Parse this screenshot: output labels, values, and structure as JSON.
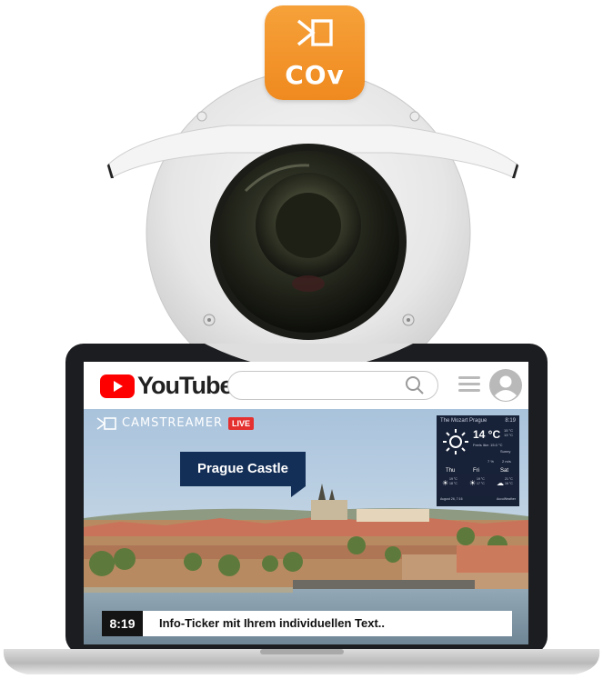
{
  "app_icon": {
    "label": "COv",
    "icon": "camstreamer-logo-icon"
  },
  "youtube": {
    "logo_text": "YouTube",
    "search_placeholder": "",
    "icons": {
      "search": "search-icon",
      "menu": "menu-icon",
      "avatar": "avatar-icon"
    }
  },
  "stream": {
    "brand": "CAMSTREAMER",
    "live_badge": "LIVE",
    "callout": "Prague Castle",
    "weather": {
      "location": "The Mozart Prague",
      "time": "8:19",
      "temp": "14 °C",
      "hi_lo": "15 °C\n13 °C",
      "feels_like": "Feels like: 15.0 °C",
      "condition": "Sunny",
      "precip": "7 %",
      "wind": "2 m/s",
      "days": [
        {
          "day": "Thu",
          "hi": "19 °C",
          "lo": "18 °C"
        },
        {
          "day": "Fri",
          "hi": "19 °C",
          "lo": "17 °C"
        },
        {
          "day": "Sat",
          "hi": "21 °C",
          "lo": "16 °C"
        }
      ],
      "date": "August 26, 7:16",
      "provider": "AccuWeather"
    },
    "ticker": {
      "time": "8:19",
      "text": "Info-Ticker mit Ihrem individuellen Text.."
    }
  },
  "colors": {
    "youtube_red": "#ff0000",
    "camstreamer_orange": "#f29125",
    "callout_navy": "#142f57",
    "live_red": "#e53030"
  }
}
